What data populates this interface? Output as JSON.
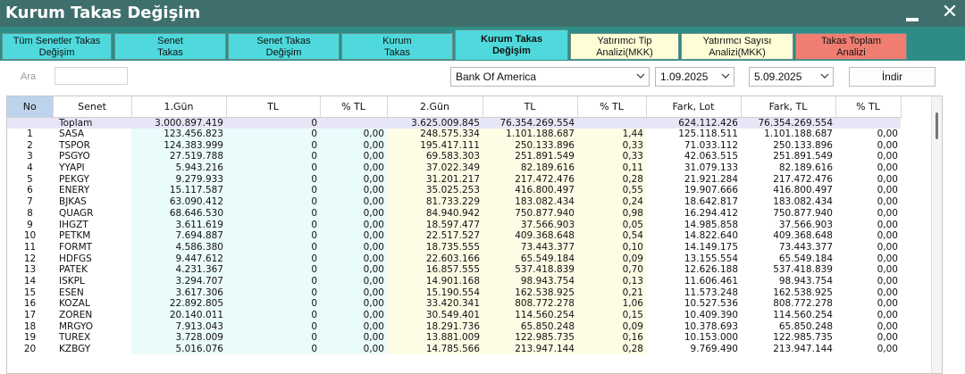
{
  "window": {
    "title": "Kurum Takas Değişim",
    "minimize_icon": "minimize-icon",
    "close_symbol": "✕"
  },
  "tabs": [
    {
      "line1": "Tüm Senetler Takas",
      "line2": "Değişim",
      "style": "cyan"
    },
    {
      "line1": "Senet",
      "line2": "Takas",
      "style": "cyan"
    },
    {
      "line1": "Senet Takas",
      "line2": "Değişim",
      "style": "cyan"
    },
    {
      "line1": "Kurum",
      "line2": "Takas",
      "style": "cyan"
    },
    {
      "line1": "Kurum Takas",
      "line2": "Değişim",
      "style": "active"
    },
    {
      "line1": "Yatırımcı Tip",
      "line2": "Analizi(MKK)",
      "style": "yellow"
    },
    {
      "line1": "Yatırımcı Sayısı",
      "line2": "Analizi(MKK)",
      "style": "yellow"
    },
    {
      "line1": "Takas Toplam",
      "line2": "Analizi",
      "style": "red"
    }
  ],
  "toolbar": {
    "search_label": "Ara",
    "search_value": "",
    "broker": "Bank Of America",
    "date_start": "1.09.2025",
    "date_end": "5.09.2025",
    "download_label": "İndir"
  },
  "table": {
    "headers": [
      "No",
      "Senet",
      "1.Gün",
      "TL",
      "% TL",
      "2.Gün",
      "TL",
      "% TL",
      "Fark, Lot",
      "Fark, TL",
      "% TL"
    ],
    "total": {
      "no": "",
      "senet": "Toplam",
      "gun1": "3.000.897.419",
      "tl1": "0",
      "pct1": "",
      "gun2": "3.625.009.845",
      "tl2": "76.354.269.554",
      "pct2": "",
      "fark_lot": "624.112.426",
      "fark_tl": "76.354.269.554",
      "pct3": ""
    },
    "rows": [
      [
        "1",
        "SASA",
        "123.456.823",
        "0",
        "0,00",
        "248.575.334",
        "1.101.188.687",
        "1,44",
        "125.118.511",
        "1.101.188.687",
        "0,00"
      ],
      [
        "2",
        "TSPOR",
        "124.383.999",
        "0",
        "0,00",
        "195.417.111",
        "250.133.896",
        "0,33",
        "71.033.112",
        "250.133.896",
        "0,00"
      ],
      [
        "3",
        "PSGYO",
        "27.519.788",
        "0",
        "0,00",
        "69.583.303",
        "251.891.549",
        "0,33",
        "42.063.515",
        "251.891.549",
        "0,00"
      ],
      [
        "4",
        "YYAPI",
        "5.943.216",
        "0",
        "0,00",
        "37.022.349",
        "82.189.616",
        "0,11",
        "31.079.133",
        "82.189.616",
        "0,00"
      ],
      [
        "5",
        "PEKGY",
        "9.279.933",
        "0",
        "0,00",
        "31.201.217",
        "217.472.476",
        "0,28",
        "21.921.284",
        "217.472.476",
        "0,00"
      ],
      [
        "6",
        "ENERY",
        "15.117.587",
        "0",
        "0,00",
        "35.025.253",
        "416.800.497",
        "0,55",
        "19.907.666",
        "416.800.497",
        "0,00"
      ],
      [
        "7",
        "BJKAS",
        "63.090.412",
        "0",
        "0,00",
        "81.733.229",
        "183.082.434",
        "0,24",
        "18.642.817",
        "183.082.434",
        "0,00"
      ],
      [
        "8",
        "QUAGR",
        "68.646.530",
        "0",
        "0,00",
        "84.940.942",
        "750.877.940",
        "0,98",
        "16.294.412",
        "750.877.940",
        "0,00"
      ],
      [
        "9",
        "IHGZT",
        "3.611.619",
        "0",
        "0,00",
        "18.597.477",
        "37.566.903",
        "0,05",
        "14.985.858",
        "37.566.903",
        "0,00"
      ],
      [
        "10",
        "PETKM",
        "7.694.887",
        "0",
        "0,00",
        "22.517.527",
        "409.368.648",
        "0,54",
        "14.822.640",
        "409.368.648",
        "0,00"
      ],
      [
        "11",
        "FORMT",
        "4.586.380",
        "0",
        "0,00",
        "18.735.555",
        "73.443.377",
        "0,10",
        "14.149.175",
        "73.443.377",
        "0,00"
      ],
      [
        "12",
        "HDFGS",
        "9.447.612",
        "0",
        "0,00",
        "22.603.166",
        "65.549.184",
        "0,09",
        "13.155.554",
        "65.549.184",
        "0,00"
      ],
      [
        "13",
        "PATEK",
        "4.231.367",
        "0",
        "0,00",
        "16.857.555",
        "537.418.839",
        "0,70",
        "12.626.188",
        "537.418.839",
        "0,00"
      ],
      [
        "14",
        "ISKPL",
        "3.294.707",
        "0",
        "0,00",
        "14.901.168",
        "98.943.754",
        "0,13",
        "11.606.461",
        "98.943.754",
        "0,00"
      ],
      [
        "15",
        "ESEN",
        "3.617.306",
        "0",
        "0,00",
        "15.190.554",
        "162.538.925",
        "0,21",
        "11.573.248",
        "162.538.925",
        "0,00"
      ],
      [
        "16",
        "KOZAL",
        "22.892.805",
        "0",
        "0,00",
        "33.420.341",
        "808.772.278",
        "1,06",
        "10.527.536",
        "808.772.278",
        "0,00"
      ],
      [
        "17",
        "ZOREN",
        "20.140.011",
        "0",
        "0,00",
        "30.549.401",
        "114.560.254",
        "0,15",
        "10.409.390",
        "114.560.254",
        "0,00"
      ],
      [
        "18",
        "MRGYO",
        "7.913.043",
        "0",
        "0,00",
        "18.291.736",
        "65.850.248",
        "0,09",
        "10.378.693",
        "65.850.248",
        "0,00"
      ],
      [
        "19",
        "TUREX",
        "3.728.009",
        "0",
        "0,00",
        "13.881.009",
        "122.985.735",
        "0,16",
        "10.153.000",
        "122.985.735",
        "0,00"
      ],
      [
        "20",
        "KZBGY",
        "5.016.076",
        "0",
        "0,00",
        "14.785.566",
        "213.947.144",
        "0,28",
        "9.769.490",
        "213.947.144",
        "0,00"
      ]
    ]
  }
}
